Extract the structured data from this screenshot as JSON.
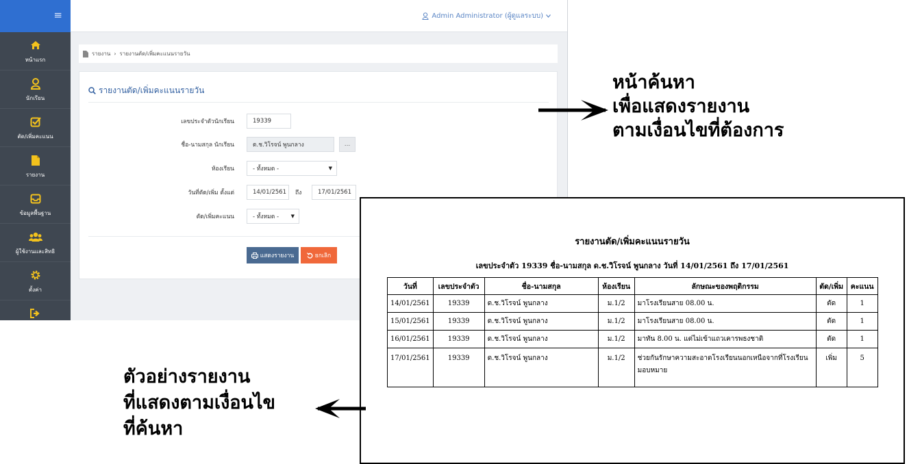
{
  "sidebar": {
    "toggle": "≡",
    "items": [
      {
        "label": "หน้าแรก",
        "icon": "home-icon"
      },
      {
        "label": "นักเรียน",
        "icon": "user-icon"
      },
      {
        "label": "ตัด/เพิ่มคะแนน",
        "icon": "checkbox-edit-icon"
      },
      {
        "label": "รายงาน",
        "icon": "document-icon"
      },
      {
        "label": "ข้อมูลพื้นฐาน",
        "icon": "inbox-icon"
      },
      {
        "label": "ผู้ใช้งานและสิทธิ",
        "icon": "users-icon"
      },
      {
        "label": "ตั้งค่า",
        "icon": "gear-icon"
      },
      {
        "label": "",
        "icon": "sign-out-icon"
      }
    ]
  },
  "header": {
    "user": "Admin Administrator (ผู้ดูแลระบบ)"
  },
  "breadcrumb": {
    "root": "รายงาน",
    "sep": "›",
    "current": "รายงานตัด/เพิ่มคะแนนรายวัน"
  },
  "panel": {
    "title": "รายงานตัด/เพิ่มคะแนนรายวัน"
  },
  "form": {
    "student_id_label": "เลขประจำตัวนักเรียน",
    "student_id_value": "19339",
    "student_name_label": "ชื่อ-นามสกุล นักเรียน",
    "student_name_value": "ด.ช.วิโรจน์ พูนกลาง",
    "browse_label": "...",
    "room_label": "ห้องเรียน",
    "room_value": "- ทั้งหมด -",
    "date_from_label": "วันที่ตัด/เพิ่ม ตั้งแต่",
    "date_from_value": "14/01/2561",
    "to_label": "ถึง",
    "date_to_value": "17/01/2561",
    "type_label": "ตัด/เพิ่มคะแนน",
    "type_value": "- ทั้งหมด -",
    "show_button": "แสดงรายงาน",
    "cancel_button": "ยกเลิก"
  },
  "annotations": {
    "search_page": [
      "หน้าค้นหา",
      "เพื่อแสดงรายงาน",
      "ตามเงื่อนไขที่ต้องการ"
    ],
    "example_report": [
      "ตัวอย่างรายงาน",
      "ที่แสดงตามเงื่อนไข",
      "ที่ค้นหา"
    ]
  },
  "report": {
    "title": "รายงานตัด/เพิ่มคะแนนรายวัน",
    "subtitle": "เลขประจำตัว 19339 ชื่อ-นามสกุล ด.ช.วิโรจน์ พูนกลาง วันที่ 14/01/2561 ถึง 17/01/2561",
    "columns": [
      "วันที่",
      "เลขประจำตัว",
      "ชื่อ-นามสกุล",
      "ห้องเรียน",
      "ลักษณะของพฤติกรรม",
      "ตัด/เพิ่ม",
      "คะแนน"
    ],
    "rows": [
      [
        "14/01/2561",
        "19339",
        "ด.ช.วิโรจน์ พูนกลาง",
        "ม.1/2",
        "มาโรงเรียนสาย 08.00 น.",
        "ตัด",
        "1"
      ],
      [
        "15/01/2561",
        "19339",
        "ด.ช.วิโรจน์ พูนกลาง",
        "ม.1/2",
        "มาโรงเรียนสาย 08.00 น.",
        "ตัด",
        "1"
      ],
      [
        "16/01/2561",
        "19339",
        "ด.ช.วิโรจน์ พูนกลาง",
        "ม.1/2",
        "มาทัน 8.00 น. แต่ไม่เข้าแถวเคารพธงชาติ",
        "ตัด",
        "1"
      ],
      [
        "17/01/2561",
        "19339",
        "ด.ช.วิโรจน์ พูนกลาง",
        "ม.1/2",
        "ช่วยกันรักษาความสะอาดโรงเรียนนอกเหนือจากที่โรงเรียนมอบหมาย",
        "เพิ่ม",
        "5"
      ]
    ]
  }
}
